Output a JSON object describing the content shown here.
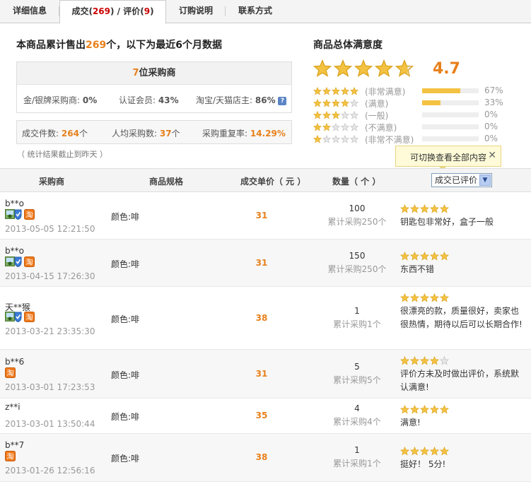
{
  "tabs": [
    {
      "label": "详细信息"
    },
    {
      "label_pre": "成交(",
      "count1": "269",
      "label_mid": ") / 评价(",
      "count2": "9",
      "label_post": ")"
    },
    {
      "label": "订购说明"
    },
    {
      "label": "联系方式"
    }
  ],
  "summary": {
    "pre": "本商品累计售出",
    "count": "269",
    "post": "个，以下为最近6个月数据",
    "buyers_count": "7",
    "buyers_label": "位采购商",
    "gold_label": "金/银牌采购商:",
    "gold_value": "0%",
    "member_label": "认证会员:",
    "member_value": "43%",
    "taobao_label": "淘宝/天猫店主:",
    "taobao_value": "86%",
    "help_icon": "?",
    "deals_label": "成交件数:",
    "deals_value": "264",
    "deals_unit": "个",
    "avg_label": "人均采购数:",
    "avg_value": "37",
    "avg_unit": "个",
    "repeat_label": "采购重复率:",
    "repeat_value": "14.29%",
    "note": "（ 统计结果截止到昨天 ）"
  },
  "satisfaction": {
    "title": "商品总体满意度",
    "score": "4.7",
    "score_fraction": 0.94,
    "distribution": [
      {
        "stars": 5,
        "label": "(非常满意)",
        "fraction": 0.67,
        "pct": "67%"
      },
      {
        "stars": 4,
        "label": "(满意)",
        "fraction": 0.33,
        "pct": "33%"
      },
      {
        "stars": 3,
        "label": "(一般)",
        "fraction": 0.0,
        "pct": "0%"
      },
      {
        "stars": 2,
        "label": "(不满意)",
        "fraction": 0.0,
        "pct": "0%"
      },
      {
        "stars": 1,
        "label": "(非常不满意)",
        "fraction": 0.0,
        "pct": "0%"
      }
    ]
  },
  "tooltip": {
    "text": "可切换查看全部内容",
    "close": "✕"
  },
  "table": {
    "headers": {
      "buyer": "采购商",
      "spec": "商品规格",
      "price": "成交单价（ 元 ）",
      "qty": "数量（ 个 ）"
    },
    "filter": {
      "selected": "成交已评价",
      "arrow": "▼"
    },
    "rows": [
      {
        "name": "b**o",
        "badges": [
          "member",
          "tao"
        ],
        "date": "2013-05-05 12:21:50",
        "spec": "颜色:啡",
        "price": "31",
        "qty": "100",
        "total": "累计采购250个",
        "stars": 5,
        "comment": "钥匙包非常好，盒子一般"
      },
      {
        "name": "b**o",
        "badges": [
          "member",
          "tao"
        ],
        "date": "2013-04-15 17:26:30",
        "spec": "颜色:啡",
        "price": "31",
        "qty": "150",
        "total": "累计采购250个",
        "stars": 5,
        "comment": "东西不错"
      },
      {
        "name": "天**猴",
        "badges": [
          "member",
          "tao"
        ],
        "date": "2013-03-21 23:35:30",
        "spec": "颜色:啡",
        "price": "38",
        "qty": "1",
        "total": "累计采购1个",
        "stars": 5,
        "comment": "很漂亮的款，质量很好，卖家也很热情，期待以后可以长期合作!"
      },
      {
        "name": "b**6",
        "badges": [
          "tao"
        ],
        "date": "2013-03-01 17:23:53",
        "spec": "颜色:啡",
        "price": "31",
        "qty": "5",
        "total": "累计采购5个",
        "stars": 4,
        "comment": "评价方未及时做出评价，系统默认满意!"
      },
      {
        "name": "z**i",
        "badges": [],
        "date": "2013-03-01 13:50:44",
        "spec": "颜色:啡",
        "price": "35",
        "qty": "4",
        "total": "累计采购4个",
        "stars": 5,
        "comment": "满意!"
      },
      {
        "name": "b**7",
        "badges": [
          "tao"
        ],
        "date": "2013-01-26 12:56:16",
        "spec": "颜色:啡",
        "price": "38",
        "qty": "1",
        "total": "累计采购1个",
        "stars": 5,
        "comment": "挺好！ 5分!"
      }
    ]
  },
  "icons": {
    "star": "star-icon",
    "member": "verified-member-icon",
    "tao": "taobao-icon",
    "help": "help-icon",
    "close": "close-icon"
  },
  "colors": {
    "accent": "#e8801b",
    "tab_count": "#cc0000",
    "star": "#f4c242",
    "bar_fill": "#f4c242"
  }
}
